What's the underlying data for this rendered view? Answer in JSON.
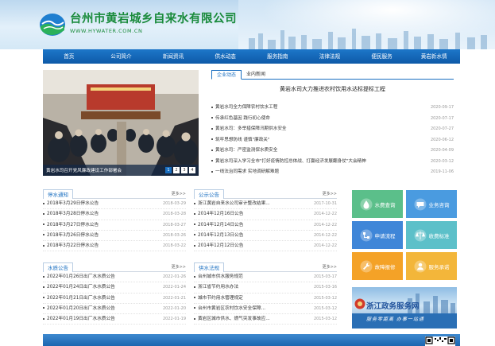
{
  "header": {
    "title": "台州市黄岩城乡自来水有限公司",
    "url": "WWW.HYWATER.COM.CN"
  },
  "nav": {
    "items": [
      "首页",
      "公司简介",
      "新闻资讯",
      "供水动态",
      "服务指南",
      "法律法规",
      "便民服务",
      "黄岩新水情"
    ]
  },
  "slider": {
    "caption": "黄岩水司召开党风廉政建设工作部署会",
    "pages": [
      "1",
      "2",
      "3",
      "4"
    ]
  },
  "news": {
    "tabs": [
      "企业动态",
      "业内新闻"
    ],
    "headline": "黄岩水司大力推进农村饮用水达标提标工程",
    "items": [
      {
        "title": "黄岩水司全力保障农村饮水工程",
        "date": "2020-09-17"
      },
      {
        "title": "传承红色基因 践行初心使命",
        "date": "2020-07-17"
      },
      {
        "title": "黄岩水司：多举措保障汛期供水安全",
        "date": "2020-07-27"
      },
      {
        "title": "筑牢思想防线 谨慎\"廉政关\"",
        "date": "2020-06-12"
      },
      {
        "title": "黄岩水司：严密监测保水质安全",
        "date": "2020-04-09"
      },
      {
        "title": "黄岩水司深入学习全市\"打好疫情防控总体战、打赢经济发展翻身仗\"大会精神",
        "date": "2020-03-12"
      },
      {
        "title": "一线法治同需求 实地调研解难题",
        "date": "2019-11-06"
      }
    ]
  },
  "panels": {
    "stop_water": {
      "title": "停水通知",
      "more": "更多>>",
      "items": [
        {
          "title": "2018年3月29日停水公告",
          "date": "2018-03-29"
        },
        {
          "title": "2018年3月28日停水公告",
          "date": "2018-03-28"
        },
        {
          "title": "2018年3月27日停水公告",
          "date": "2018-03-27"
        },
        {
          "title": "2018年3月26日停水公告",
          "date": "2018-03-26"
        },
        {
          "title": "2018年3月22日停水公告",
          "date": "2018-03-22"
        }
      ]
    },
    "public": {
      "title": "公示公告",
      "more": "更多>>",
      "items": [
        {
          "title": "浙江黄岩自来水公司审计整改结果...",
          "date": "2017-10-31"
        },
        {
          "title": "2014年12月16日公告",
          "date": "2014-12-22"
        },
        {
          "title": "2014年12月14日公告",
          "date": "2014-12-22"
        },
        {
          "title": "2014年12月13日公告",
          "date": "2014-12-22"
        },
        {
          "title": "2014年12月12日公告",
          "date": "2014-12-22"
        }
      ]
    },
    "quality": {
      "title": "水质公告",
      "more": "更多>>",
      "items": [
        {
          "title": "2022年01月26日出厂水水质公告",
          "date": "2022-01-26"
        },
        {
          "title": "2022年01月24日出厂水水质公告",
          "date": "2022-01-24"
        },
        {
          "title": "2022年01月21日出厂水水质公告",
          "date": "2022-01-21"
        },
        {
          "title": "2022年01月20日出厂水水质公告",
          "date": "2022-01-20"
        },
        {
          "title": "2022年01月19日出厂水水质公告",
          "date": "2022-01-19"
        }
      ]
    },
    "knowledge": {
      "title": "供水法规",
      "more": "更多>>",
      "items": [
        {
          "title": "台州城市供水服务规范",
          "date": "2015-03-17"
        },
        {
          "title": "浙江省节约用水办法",
          "date": "2015-03-16"
        },
        {
          "title": "城市节约用水管理规定",
          "date": "2015-03-12"
        },
        {
          "title": "台州市黄岩区农村饮水安全保障...",
          "date": "2015-03-12"
        },
        {
          "title": "黄岩区城市供水、燃气突发事故应...",
          "date": "2015-03-12"
        }
      ]
    },
    "more_label": "更多>>"
  },
  "tiles": [
    {
      "label": "水费查询",
      "icon": "water-drop-icon",
      "color": "#5bbf8a"
    },
    {
      "label": "业务咨询",
      "icon": "chat-icon",
      "color": "#4a9be0"
    },
    {
      "label": "申请流程",
      "icon": "flow-icon",
      "color": "#3f86d8"
    },
    {
      "label": "收费标准",
      "icon": "scale-icon",
      "color": "#5cc0c9"
    },
    {
      "label": "故障报修",
      "icon": "wrench-icon",
      "color": "#f4a227"
    },
    {
      "label": "服务承诺",
      "icon": "person-icon",
      "color": "#f3b63a"
    }
  ],
  "banner": {
    "title": "浙江政务服务网",
    "subtitle": "服务零距离 办事一站通"
  }
}
